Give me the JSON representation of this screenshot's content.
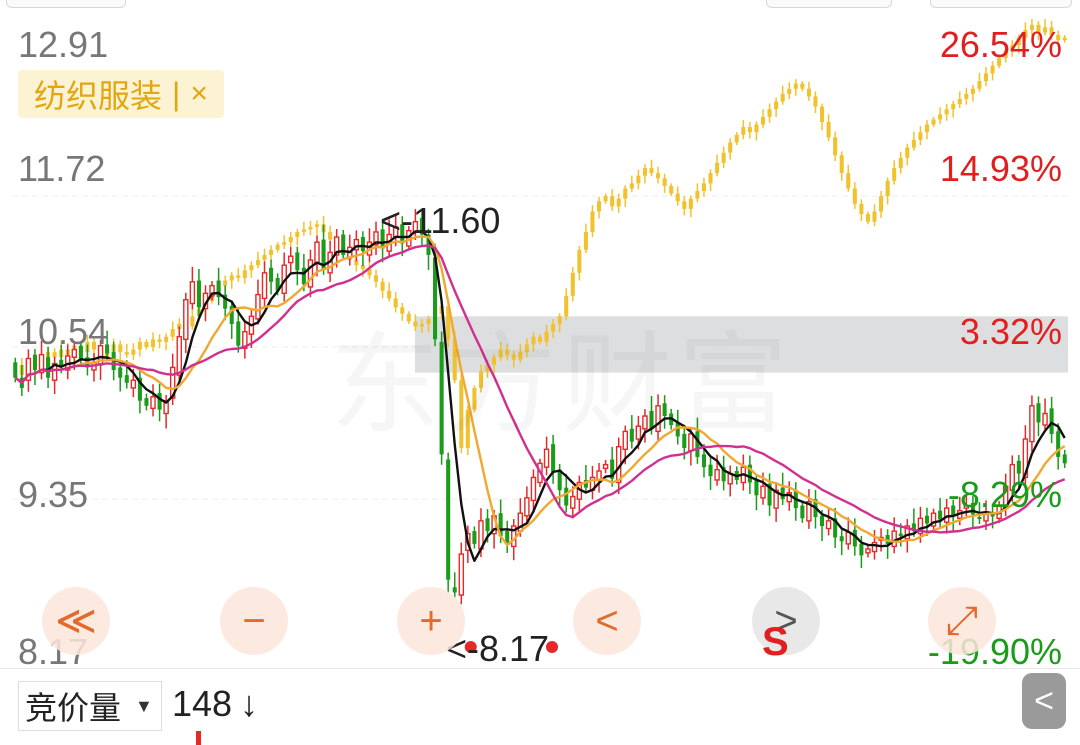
{
  "chart_data": {
    "type": "candlestick",
    "y_axis": {
      "ticks": [
        "12.91",
        "11.72",
        "10.54",
        "9.35",
        "8.17"
      ],
      "range": [
        8.17,
        12.91
      ]
    },
    "pct_axis": {
      "ticks": [
        "26.54%",
        "14.93%",
        "3.32%",
        "-8.29%",
        "-19.90%"
      ]
    },
    "max_annotation": "<-11.60",
    "min_annotation": "<-8.17",
    "overlay_label": "纺织服装",
    "overlay_separator": "|",
    "close_icon": "×",
    "colors": {
      "up": "#e62828",
      "down": "#1a9c1a",
      "overlay": "#f2c22e",
      "ma_black": "#111111",
      "ma_orange": "#f0a830",
      "ma_magenta": "#d0308f",
      "band": "#d9dadc",
      "pct_up": "#e02020",
      "pct_down": "#1a9c1a"
    },
    "stock_close": [
      10.3,
      10.22,
      10.45,
      10.36,
      10.48,
      10.3,
      10.41,
      10.38,
      10.47,
      10.52,
      10.44,
      10.38,
      10.42,
      10.55,
      10.49,
      10.36,
      10.3,
      10.26,
      10.28,
      10.12,
      10.08,
      10.15,
      10.05,
      10.12,
      10.38,
      10.62,
      10.91,
      11.05,
      10.85,
      10.96,
      11.02,
      10.93,
      10.84,
      10.72,
      10.55,
      10.66,
      10.78,
      10.95,
      11.12,
      11.05,
      10.98,
      11.18,
      11.25,
      11.14,
      11.03,
      11.22,
      11.36,
      11.15,
      11.28,
      11.4,
      11.26,
      11.32,
      11.38,
      11.29,
      11.36,
      11.44,
      11.31,
      11.42,
      11.48,
      11.35,
      11.45,
      11.52,
      11.42,
      11.26,
      10.6,
      9.7,
      8.72,
      8.62,
      8.92,
      9.08,
      9.0,
      9.18,
      9.1,
      9.22,
      9.06,
      9.01,
      9.14,
      9.24,
      9.36,
      9.52,
      9.63,
      9.74,
      9.56,
      9.42,
      9.3,
      9.37,
      9.48,
      9.44,
      9.52,
      9.57,
      9.62,
      9.51,
      9.76,
      9.88,
      9.8,
      9.92,
      10.0,
      9.9,
      10.08,
      10.0,
      9.93,
      9.84,
      9.75,
      9.86,
      9.68,
      9.6,
      9.53,
      9.58,
      9.49,
      9.55,
      9.5,
      9.6,
      9.48,
      9.38,
      9.45,
      9.3,
      9.42,
      9.35,
      9.4,
      9.28,
      9.2,
      9.33,
      9.21,
      9.14,
      9.18,
      9.05,
      9.02,
      9.09,
      8.98,
      8.91,
      8.96,
      9.01,
      9.05,
      9.0,
      9.1,
      9.06,
      9.14,
      9.1,
      9.2,
      9.16,
      9.24,
      9.19,
      9.28,
      9.22,
      9.26,
      9.3,
      9.23,
      9.2,
      9.25,
      9.22,
      9.3,
      9.45,
      9.62,
      9.55,
      9.82,
      10.08,
      9.95,
      10.02,
      9.86,
      9.68,
      9.63
    ],
    "stock_open": [
      10.42,
      10.3,
      10.28,
      10.48,
      10.34,
      10.46,
      10.28,
      10.44,
      10.36,
      10.46,
      10.55,
      10.46,
      10.36,
      10.4,
      10.56,
      10.5,
      10.38,
      10.32,
      10.22,
      10.3,
      10.14,
      10.06,
      10.18,
      10.02,
      10.14,
      10.32,
      10.6,
      10.88,
      11.06,
      10.84,
      10.94,
      11.06,
      10.95,
      10.86,
      10.74,
      10.53,
      10.64,
      10.76,
      10.92,
      11.16,
      11.08,
      10.96,
      11.2,
      11.28,
      11.16,
      11.01,
      11.2,
      11.38,
      11.12,
      11.26,
      11.42,
      11.24,
      11.3,
      11.4,
      11.26,
      11.34,
      11.46,
      11.29,
      11.4,
      11.5,
      11.33,
      11.44,
      11.55,
      11.42,
      11.24,
      10.58,
      9.66,
      8.66,
      8.6,
      8.95,
      9.1,
      8.96,
      9.2,
      9.08,
      9.24,
      9.1,
      8.98,
      9.1,
      9.22,
      9.34,
      9.48,
      9.6,
      9.78,
      9.58,
      9.44,
      9.28,
      9.35,
      9.5,
      9.42,
      9.5,
      9.59,
      9.66,
      9.48,
      9.74,
      9.9,
      9.82,
      9.9,
      10.04,
      9.88,
      10.1,
      10.02,
      9.95,
      9.86,
      9.73,
      9.88,
      9.7,
      9.62,
      9.5,
      9.6,
      9.47,
      9.57,
      9.48,
      9.62,
      9.5,
      9.36,
      9.47,
      9.28,
      9.44,
      9.33,
      9.42,
      9.3,
      9.18,
      9.35,
      9.22,
      9.12,
      9.2,
      9.06,
      9.0,
      9.11,
      9.0,
      8.93,
      8.94,
      9.03,
      9.07,
      8.98,
      9.08,
      9.04,
      9.16,
      9.08,
      9.22,
      9.14,
      9.26,
      9.17,
      9.3,
      9.2,
      9.28,
      9.32,
      9.21,
      9.18,
      9.23,
      9.2,
      9.28,
      9.42,
      9.65,
      9.52,
      9.8,
      10.1,
      9.93,
      10.06,
      9.88,
      9.7
    ],
    "overlay_close": [
      10.32,
      10.4,
      10.36,
      10.44,
      10.4,
      10.5,
      10.46,
      10.52,
      10.48,
      10.55,
      10.5,
      10.58,
      10.52,
      10.46,
      10.5,
      10.56,
      10.5,
      10.48,
      10.52,
      10.58,
      10.54,
      10.6,
      10.58,
      10.62,
      10.68,
      10.72,
      10.7,
      10.78,
      10.84,
      10.9,
      10.98,
      11.02,
      11.06,
      11.1,
      11.08,
      11.14,
      11.18,
      11.22,
      11.26,
      11.3,
      11.34,
      11.36,
      11.4,
      11.44,
      11.46,
      11.48,
      11.5,
      11.44,
      11.38,
      11.32,
      11.28,
      11.22,
      11.18,
      11.15,
      11.1,
      11.05,
      10.98,
      10.92,
      10.85,
      10.8,
      10.74,
      10.7,
      10.72,
      10.76,
      10.8,
      10.86,
      10.6,
      10.28,
      9.75,
      10.05,
      10.22,
      10.35,
      10.4,
      10.46,
      10.52,
      10.48,
      10.44,
      10.5,
      10.56,
      10.62,
      10.58,
      10.66,
      10.72,
      10.78,
      10.94,
      11.12,
      11.3,
      11.44,
      11.6,
      11.68,
      11.72,
      11.64,
      11.7,
      11.78,
      11.82,
      11.88,
      11.94,
      11.9,
      11.86,
      11.8,
      11.74,
      11.68,
      11.62,
      11.7,
      11.76,
      11.82,
      11.9,
      11.98,
      12.06,
      12.14,
      12.2,
      12.26,
      12.22,
      12.28,
      12.34,
      12.4,
      12.46,
      12.52,
      12.56,
      12.6,
      12.56,
      12.5,
      12.42,
      12.3,
      12.18,
      12.04,
      11.9,
      11.78,
      11.66,
      11.58,
      11.52,
      11.6,
      11.72,
      11.84,
      11.94,
      12.02,
      12.1,
      12.16,
      12.22,
      12.28,
      12.32,
      12.36,
      12.4,
      12.44,
      12.48,
      12.52,
      12.56,
      12.62,
      12.68,
      12.74,
      12.8,
      12.86,
      12.9,
      12.96,
      13.02,
      13.06,
      13.0,
      13.04,
      12.98,
      12.94,
      12.96
    ]
  },
  "controls": {
    "back_icon": "≪",
    "zoom_out_icon": "−",
    "crosshair_icon": "+",
    "prev_icon": "<",
    "next_icon": ">",
    "fullscreen_icon": "⤢",
    "signal_letter": "S"
  },
  "bottom": {
    "indicator_label": "竞价量",
    "dropdown_icon": "▼",
    "volume_value": "148",
    "volume_direction": "↓",
    "collapse_icon": "<"
  }
}
